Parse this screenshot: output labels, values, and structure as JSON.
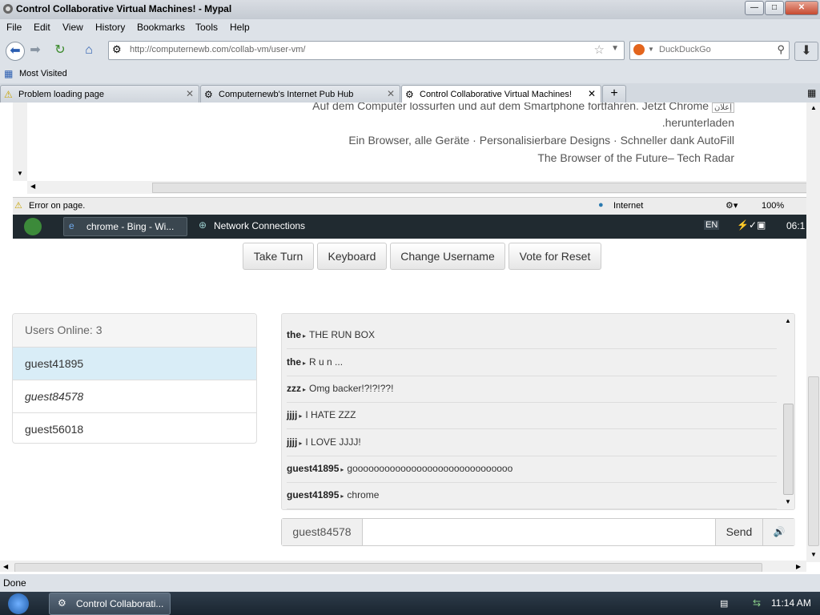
{
  "window": {
    "title": "Control Collaborative Virtual Machines! - Mypal"
  },
  "menu": [
    "File",
    "Edit",
    "View",
    "History",
    "Bookmarks",
    "Tools",
    "Help"
  ],
  "nav": {
    "url": "http://computernewb.com/collab-vm/user-vm/",
    "search_placeholder": "DuckDuckGo"
  },
  "bookmarks": {
    "most_visited": "Most Visited"
  },
  "tabs": [
    {
      "label": "Problem loading page",
      "icon": "warning-icon",
      "active": false
    },
    {
      "label": "Computernewb's Internet Pub Hub",
      "icon": "site-icon",
      "active": false
    },
    {
      "label": "Control Collaborative Virtual Machines!",
      "icon": "site-icon",
      "active": true
    }
  ],
  "vm": {
    "ad_lines": [
      "Auf dem Computer lossurfen und auf dem Smartphone fortfahren. Jetzt Chrome",
      ".herunterladen",
      "Ein Browser, alle Geräte · Personalisierbare Designs · Schneller dank AutoFill",
      "The Browser of the Future– Tech Radar"
    ],
    "ad_badge": "إعلان",
    "ie_status": "Error on page.",
    "ie_zone": "Internet",
    "ie_zoom": "100%",
    "taskbar_items": [
      "chrome - Bing - Wi...",
      "Network Connections"
    ],
    "lang": "EN",
    "clock": "06:1"
  },
  "controls": {
    "take_turn": "Take Turn",
    "keyboard": "Keyboard",
    "change_username": "Change Username",
    "vote_reset": "Vote for Reset"
  },
  "users": {
    "header": "Users Online: 3",
    "list": [
      {
        "name": "guest41895",
        "selected": true,
        "italic": false
      },
      {
        "name": "guest84578",
        "selected": false,
        "italic": true
      },
      {
        "name": "guest56018",
        "selected": false,
        "italic": false
      }
    ]
  },
  "chat": {
    "messages": [
      {
        "user": "the",
        "text": "THE RUN BOX"
      },
      {
        "user": "the",
        "text": "R u n ..."
      },
      {
        "user": "zzz",
        "text": "Omg backer!?!?!??!"
      },
      {
        "user": "jjjj",
        "text": "I HATE ZZZ"
      },
      {
        "user": "jjjj",
        "text": "I LOVE JJJJ!"
      },
      {
        "user": "guest41895",
        "text": "goooooooooooooooooooooooooooooo"
      },
      {
        "user": "guest41895",
        "text": "chrome"
      }
    ],
    "username": "guest84578",
    "input_value": "",
    "send": "Send"
  },
  "status": {
    "text": "Done"
  },
  "taskbar": {
    "item": "Control Collaborati...",
    "clock": "11:14 AM"
  },
  "colors": {
    "selected_user": "#d9edf7",
    "vm_taskbar": "#202a30"
  }
}
